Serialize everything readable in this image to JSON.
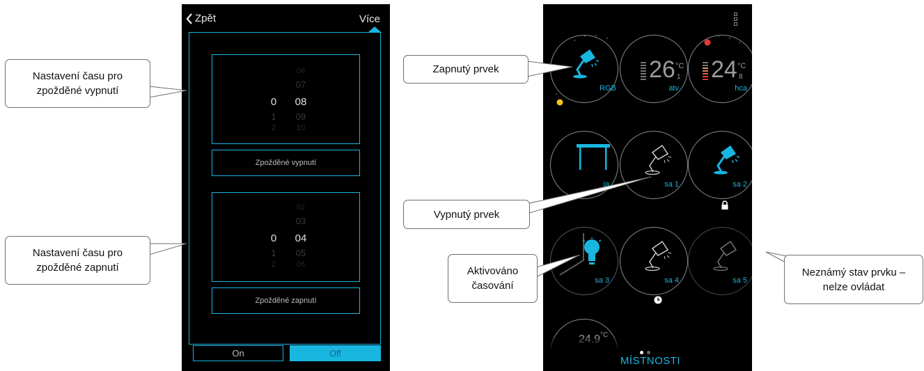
{
  "left_phone": {
    "back_label": "Zpět",
    "more_label": "Více",
    "picker_off": {
      "hours": [
        "0",
        "1",
        "2"
      ],
      "minutes": [
        "06",
        "07",
        "08",
        "09",
        "10"
      ]
    },
    "button_off_label": "Zpožděné vypnutí",
    "picker_on": {
      "hours": [
        "0",
        "1",
        "2"
      ],
      "minutes": [
        "02",
        "03",
        "04",
        "05",
        "06"
      ]
    },
    "button_on_label": "Zpožděné zapnutí",
    "toggle": {
      "on_label": "On",
      "off_label": "Off",
      "selected": "Off"
    }
  },
  "right_phone": {
    "tiles": [
      {
        "label": "RGB",
        "state": "on",
        "icon": "desk-lamp-icon"
      },
      {
        "label": "atv",
        "temperature": "26",
        "decimal": "1",
        "unit": "°C"
      },
      {
        "label": "hca",
        "temperature": "24",
        "decimal": "8",
        "unit": "°C"
      },
      {
        "label": "ia",
        "icon": "table-icon"
      },
      {
        "label": "sa 1",
        "state": "off",
        "icon": "desk-lamp-icon"
      },
      {
        "label": "sa 2",
        "state": "on",
        "icon": "desk-lamp-icon",
        "badge": "lock-icon"
      },
      {
        "label": "sa 3",
        "state": "timer",
        "icon": "bulb-icon"
      },
      {
        "label": "sa 4",
        "state": "off",
        "icon": "desk-lamp-icon",
        "badge": "clock-icon"
      },
      {
        "label": "sa 5",
        "state": "unknown",
        "icon": "desk-lamp-icon"
      },
      {
        "label": "",
        "temperature": "24.9",
        "unit": "°C"
      }
    ],
    "rooms_label": "MÍSTNOSTI",
    "page_count": 2,
    "active_page": 1
  },
  "callouts": {
    "delay_off": {
      "line1": "Nastavení času pro",
      "line2": "zpožděné vypnutí"
    },
    "delay_on": {
      "line1": "Nastavení času pro",
      "line2": "zpožděné zapnutí"
    },
    "on_item": "Zapnutý prvek",
    "off_item": "Vypnutý prvek",
    "timer_active": {
      "line1": "Aktivováno",
      "line2": "časování"
    },
    "unknown": {
      "line1": "Neznámý stav prvku –",
      "line2": "nelze ovládat"
    }
  },
  "colors": {
    "accent": "#19b6e0",
    "background": "#000000",
    "ring": "#8c8c8c"
  }
}
